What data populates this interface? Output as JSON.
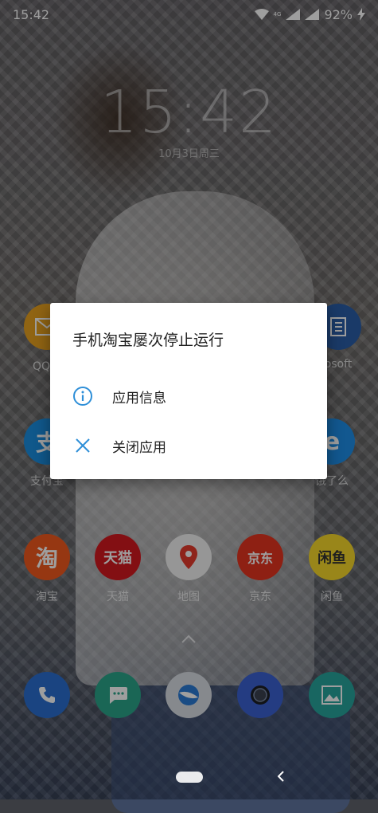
{
  "status_bar": {
    "time": "15:42",
    "network_label": "4G",
    "battery": "92%"
  },
  "lockscreen": {
    "clock": "15:42",
    "date": "10月3日周三"
  },
  "apps_row1": [
    {
      "label": "QQ邮",
      "icon": "mail-icon",
      "color": "#e9a21f"
    },
    {
      "label": "osoft",
      "icon": "office-icon",
      "color": "#2b5ea8"
    }
  ],
  "apps_row2": [
    {
      "label": "支付宝",
      "icon": "alipay-icon",
      "color": "#1b8fe0"
    },
    {
      "label": "饿了么",
      "icon": "eleme-icon",
      "color": "#1d8fe8"
    }
  ],
  "apps_row3": [
    {
      "label": "淘宝",
      "glyph": "淘",
      "icon": "taobao-icon",
      "color": "#f25a1e"
    },
    {
      "label": "天猫",
      "glyph": "天猫",
      "icon": "tmall-icon",
      "color": "#d4191f"
    },
    {
      "label": "地图",
      "icon": "map-pin-icon",
      "color": "#f2f2f2"
    },
    {
      "label": "京东",
      "glyph": "京东",
      "icon": "jd-icon",
      "color": "#e53420"
    },
    {
      "label": "闲鱼",
      "glyph": "闲鱼",
      "icon": "xianyu-icon",
      "color": "#f7d82a"
    }
  ],
  "dock": [
    {
      "icon": "phone-icon",
      "color": "#2a6fd0"
    },
    {
      "icon": "messages-icon",
      "color": "#2aa58a"
    },
    {
      "icon": "browser-icon",
      "color": "#d8dde4"
    },
    {
      "icon": "camera-icon",
      "color": "#3a62d2"
    },
    {
      "icon": "gallery-icon",
      "color": "#27a59d"
    }
  ],
  "dialog": {
    "title": "手机淘宝屡次停止运行",
    "app_info_label": "应用信息",
    "close_app_label": "关闭应用",
    "accent": "#2f8fd8"
  }
}
